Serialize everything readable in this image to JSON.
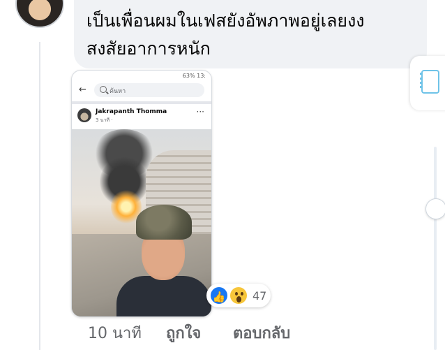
{
  "comment": {
    "author_name": "",
    "text_line1": "เป็นเพื่อนผมในเฟสยังอัพภาพอยู่เลยงง",
    "text_line2": "สงสัยอาการหนัก",
    "time": "10 นาที",
    "like_label": "ถูกใจ",
    "reply_label": "ตอบกลับ",
    "reaction_count": "47",
    "reactions": [
      "like-icon",
      "wow-icon"
    ]
  },
  "screenshot_card": {
    "status_bar": "63% 13:",
    "search_placeholder": "ค้นหา",
    "post_author": "Jakrapanth Thomma",
    "post_meta": "3 นาที ·"
  },
  "colors": {
    "bubble": "#f0f2f5",
    "like_blue": "#1877f2",
    "wow_yellow": "#f7c63b",
    "muted_text": "#65676b"
  }
}
